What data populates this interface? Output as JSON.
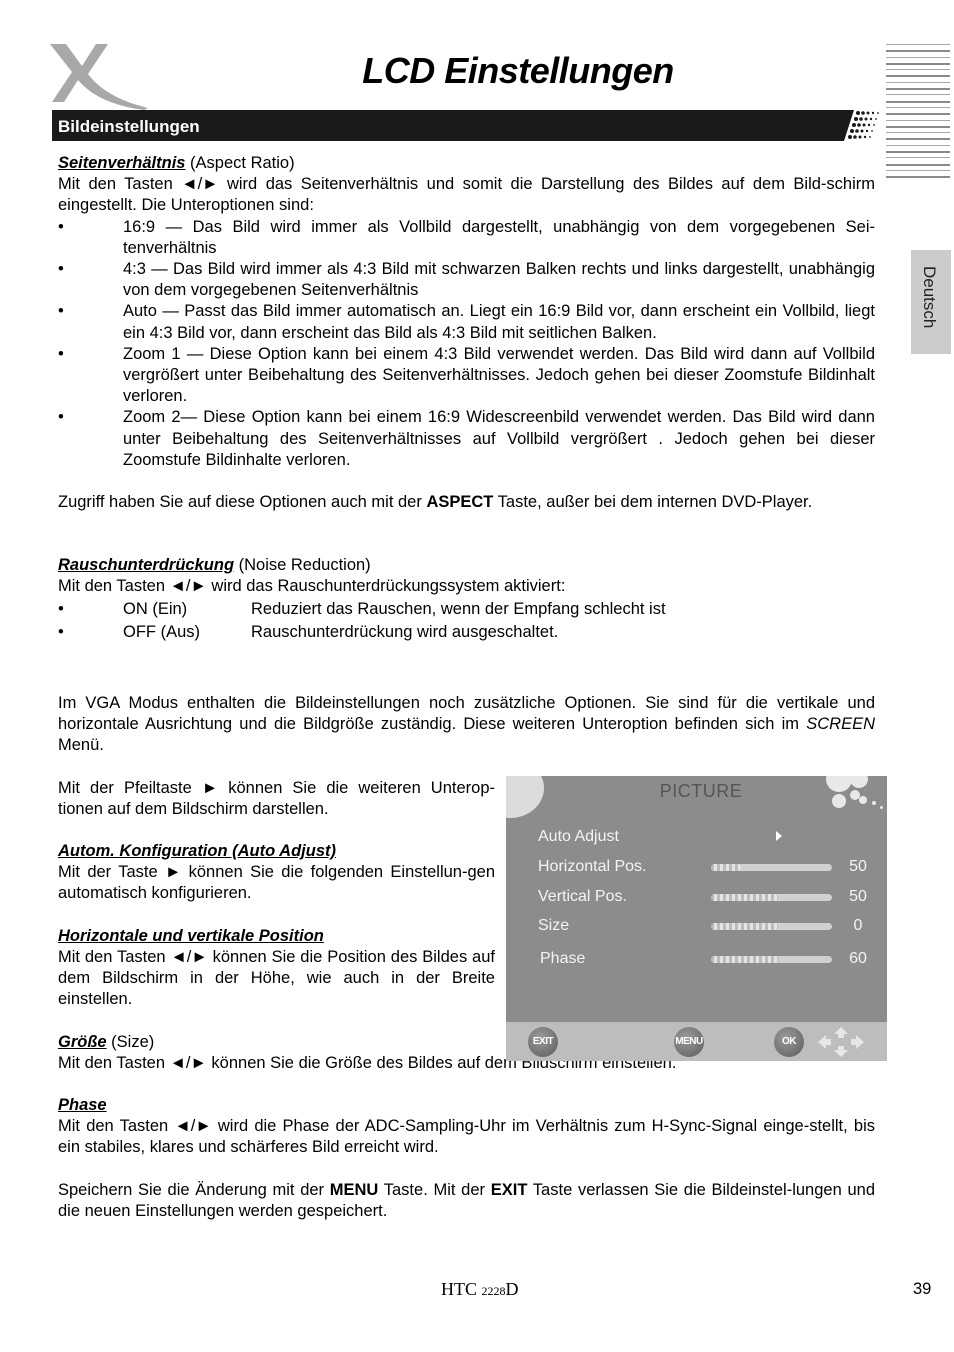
{
  "header": {
    "title": "LCD Einstellungen",
    "section": "Bildeinstellungen",
    "language_tab": "Deutsch"
  },
  "aspect": {
    "heading": "Seitenverhältnis",
    "heading_en": " (Aspect Ratio)",
    "intro": "Mit den Tasten ◄/► wird das Seitenverhältnis und somit die Darstellung des Bildes auf dem Bild-schirm eingestellt. Die Unteroptionen sind:",
    "bullets": [
      "16:9 — Das Bild wird immer als Vollbild dargestellt, unabhängig von dem vorgegebenen Sei-tenverhältnis",
      "4:3 — Das Bild wird immer als 4:3 Bild mit schwarzen Balken rechts und links dargestellt, unabhängig von dem vorgegebenen Seitenverhältnis",
      "Auto — Passt das Bild immer automatisch an. Liegt ein 16:9 Bild vor, dann erscheint ein Vollbild, liegt ein 4:3 Bild vor, dann erscheint das Bild als 4:3 Bild mit seitlichen Balken.",
      "Zoom 1 — Diese Option kann bei einem 4:3 Bild verwendet werden. Das Bild wird dann auf Vollbild vergrößert unter Beibehaltung des Seitenverhältnisses. Jedoch gehen bei dieser Zoomstufe Bildinhalt verloren.",
      "Zoom 2— Diese Option kann bei einem 16:9 Widescreenbild verwendet werden. Das Bild wird dann unter Beibehaltung des Seitenverhältnisses auf Vollbild vergrößert . Jedoch gehen bei dieser Zoomstufe Bildinhalte verloren."
    ],
    "note_pre": "Zugriff haben Sie auf diese Optionen auch mit der ",
    "note_key": "ASPECT",
    "note_post": " Taste, außer bei dem internen DVD-Player."
  },
  "noise": {
    "heading": "Rauschunterdrückung",
    "heading_en": " (Noise Reduction)",
    "intro": "Mit den Tasten ◄/► wird das Rauschunterdrückungssystem aktiviert:",
    "options": [
      {
        "key": "ON (Ein)",
        "desc": "Reduziert das Rauschen, wenn der Empfang schlecht ist"
      },
      {
        "key": "OFF (Aus)",
        "desc": "Rauschunterdrückung wird ausgeschaltet."
      }
    ]
  },
  "vga": {
    "p_pre": "Im VGA Modus enthalten die Bildeinstellungen noch zusätzliche Optionen. Sie sind für die vertikale und horizontale Ausrichtung und die Bildgröße zuständig. Diese weiteren Unteroption befinden sich im ",
    "p_em": "SCREEN",
    "p_post": " Menü.",
    "arrow_note": "Mit der Pfeiltaste ► können Sie die weiteren Unterop-tionen auf dem Bildschirm darstellen.",
    "auto_heading": "Autom. Konfiguration (Auto Adjust)",
    "auto_text": "Mit der Taste ► können Sie die folgenden Einstellun-gen automatisch konfigurieren.",
    "pos_heading": "Horizontale und vertikale Position",
    "pos_text": "Mit den Tasten ◄/► können Sie die Position des Bildes auf dem Bildschirm in der Höhe, wie auch in der Breite einstellen.",
    "size_heading": "Größe",
    "size_heading_en": " (Size)",
    "size_text": "Mit den Tasten ◄/► können Sie die Größe des Bildes auf dem Bildschirm einstellen.",
    "phase_heading": "Phase",
    "phase_text": "Mit den Tasten ◄/► wird die Phase der ADC-Sampling-Uhr im Verhältnis zum H-Sync-Signal einge-stellt, bis ein stabiles, klares und schärferes Bild erreicht wird.",
    "save_pre": "Speichern Sie die Änderung mit der ",
    "save_key1": "MENU",
    "save_mid": " Taste. Mit der ",
    "save_key2": "EXIT",
    "save_post": " Taste verlassen Sie die Bildeinstel-lungen und die neuen Einstellungen werden gespeichert."
  },
  "osd": {
    "title": "PICTURE",
    "auto_adjust_label": "Auto Adjust",
    "sliders": [
      {
        "label": "Horizontal Pos.",
        "value": "50",
        "fill": 0.25
      },
      {
        "label": "Vertical Pos.",
        "value": "50",
        "fill": 0.55
      },
      {
        "label": "Size",
        "value": "0",
        "fill": 0.55
      },
      {
        "label": "Phase",
        "value": "60",
        "fill": 0.55
      }
    ],
    "buttons": {
      "exit": "EXIT",
      "menu": "MENU",
      "ok": "OK"
    }
  },
  "footer": {
    "model_prefix": "HTC ",
    "model_number": "2228",
    "model_suffix": "D",
    "page_number": "39"
  }
}
